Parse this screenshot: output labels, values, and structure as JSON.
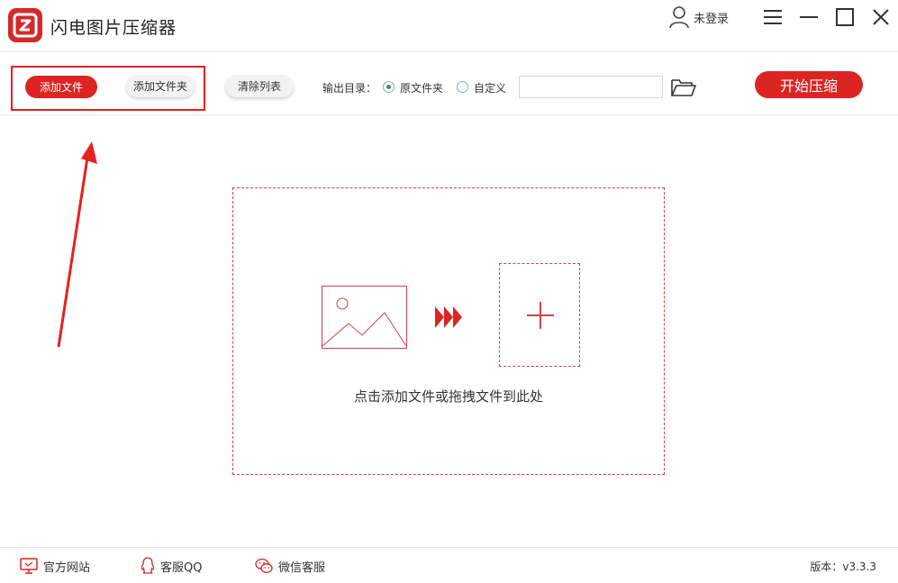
{
  "app": {
    "title": "闪电图片压缩器"
  },
  "user": {
    "label": "未登录"
  },
  "toolbar": {
    "add_file": "添加文件",
    "add_folder": "添加文件夹",
    "clear_list": "清除列表",
    "output_label": "输出目录：",
    "radio_original": "原文件夹",
    "radio_custom": "自定义",
    "output_path_value": "",
    "start": "开始压缩"
  },
  "dropzone": {
    "hint": "点击添加文件或拖拽文件到此处"
  },
  "footer": {
    "website": "官方网站",
    "qq": "客服QQ",
    "wechat": "微信客服",
    "version": "版本：v3.3.3"
  },
  "colors": {
    "accent": "#dc2522",
    "dashed_border": "#c9444a",
    "radio_checked": "#3a9a3a"
  },
  "icons": {
    "logo": "app-logo-icon",
    "user": "user-icon",
    "menu": "menu-icon",
    "minimize": "minimize-icon",
    "maximize": "maximize-icon",
    "close": "close-icon",
    "folder": "open-folder-icon",
    "image": "image-icon",
    "forward": "fast-forward-icon",
    "plus": "plus-icon",
    "monitor": "monitor-icon",
    "qq": "qq-icon",
    "wechat": "wechat-icon"
  }
}
